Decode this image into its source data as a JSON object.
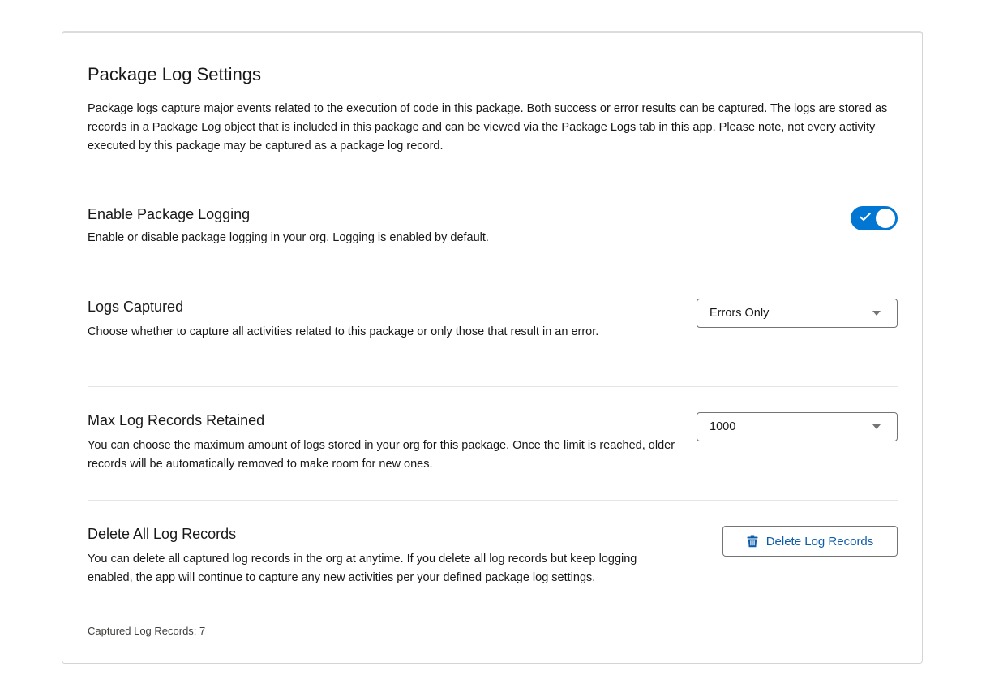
{
  "header": {
    "title": "Package Log Settings",
    "description": "Package logs capture major events related to the execution of code in this package. Both success or error results can be captured. The logs are stored as records in a Package Log object that is included in this package and can be viewed via the Package Logs tab in this app. Please note, not every activity executed by this package may be captured as a package log record."
  },
  "settings": {
    "enable_logging": {
      "title": "Enable Package Logging",
      "description": "Enable or disable package logging in your org. Logging is enabled by default.",
      "toggle_on": true,
      "toggle_icon": "check-icon"
    },
    "logs_captured": {
      "title": "Logs Captured",
      "description": "Choose whether to capture all activities related to this package or only those that result in an error.",
      "selected": "Errors Only"
    },
    "max_records": {
      "title": "Max Log Records Retained",
      "description": "You can choose the maximum amount of logs stored in your org for this package. Once the limit is reached, older records will be automatically removed to make room for new ones.",
      "selected": "1000"
    },
    "delete_records": {
      "title": "Delete All Log Records",
      "description": "You can delete all captured log records in the org at anytime. If you delete all log records but keep logging enabled, the app will continue to capture any new activities per your defined package log settings.",
      "button_label": "Delete Log Records",
      "button_icon": "trash-icon",
      "count_label": "Captured Log Records: 7"
    }
  },
  "colors": {
    "accent": "#0176d3",
    "button_text": "#0b5cab",
    "border": "#747474"
  }
}
